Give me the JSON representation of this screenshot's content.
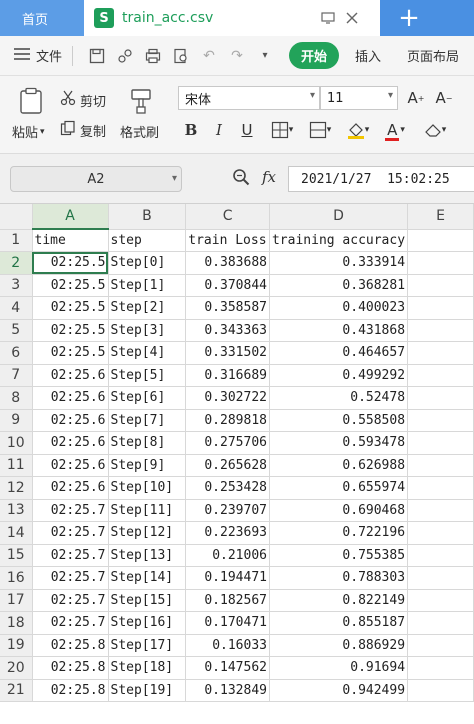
{
  "tabs": {
    "home": "首页",
    "file": "train_acc.csv"
  },
  "menu": {
    "file_label": "文件",
    "start_label": "开始",
    "insert_label": "插入",
    "layout_label": "页面布局"
  },
  "toolbar": {
    "paste_label": "粘贴",
    "cut_label": "剪切",
    "copy_label": "复制",
    "format_painter_label": "格式刷",
    "font_name": "宋体",
    "font_size": "11"
  },
  "formula": {
    "cell_ref": "A2",
    "fx": "fx",
    "value": "2021/1/27  15:02:25"
  },
  "columns": [
    "A",
    "B",
    "C",
    "D",
    "E"
  ],
  "rows": [
    {
      "n": "1",
      "a": "time",
      "b": "step",
      "c": "train Loss",
      "d": "training accuracy"
    },
    {
      "n": "2",
      "a": "02:25.5",
      "b": "Step[0]",
      "c": "0.383688",
      "d": "0.333914"
    },
    {
      "n": "3",
      "a": "02:25.5",
      "b": "Step[1]",
      "c": "0.370844",
      "d": "0.368281"
    },
    {
      "n": "4",
      "a": "02:25.5",
      "b": "Step[2]",
      "c": "0.358587",
      "d": "0.400023"
    },
    {
      "n": "5",
      "a": "02:25.5",
      "b": "Step[3]",
      "c": "0.343363",
      "d": "0.431868"
    },
    {
      "n": "6",
      "a": "02:25.5",
      "b": "Step[4]",
      "c": "0.331502",
      "d": "0.464657"
    },
    {
      "n": "7",
      "a": "02:25.6",
      "b": "Step[5]",
      "c": "0.316689",
      "d": "0.499292"
    },
    {
      "n": "8",
      "a": "02:25.6",
      "b": "Step[6]",
      "c": "0.302722",
      "d": "0.52478"
    },
    {
      "n": "9",
      "a": "02:25.6",
      "b": "Step[7]",
      "c": "0.289818",
      "d": "0.558508"
    },
    {
      "n": "10",
      "a": "02:25.6",
      "b": "Step[8]",
      "c": "0.275706",
      "d": "0.593478"
    },
    {
      "n": "11",
      "a": "02:25.6",
      "b": "Step[9]",
      "c": "0.265628",
      "d": "0.626988"
    },
    {
      "n": "12",
      "a": "02:25.6",
      "b": "Step[10]",
      "c": "0.253428",
      "d": "0.655974"
    },
    {
      "n": "13",
      "a": "02:25.7",
      "b": "Step[11]",
      "c": "0.239707",
      "d": "0.690468"
    },
    {
      "n": "14",
      "a": "02:25.7",
      "b": "Step[12]",
      "c": "0.223693",
      "d": "0.722196"
    },
    {
      "n": "15",
      "a": "02:25.7",
      "b": "Step[13]",
      "c": "0.21006",
      "d": "0.755385"
    },
    {
      "n": "16",
      "a": "02:25.7",
      "b": "Step[14]",
      "c": "0.194471",
      "d": "0.788303"
    },
    {
      "n": "17",
      "a": "02:25.7",
      "b": "Step[15]",
      "c": "0.182567",
      "d": "0.822149"
    },
    {
      "n": "18",
      "a": "02:25.7",
      "b": "Step[16]",
      "c": "0.170471",
      "d": "0.855187"
    },
    {
      "n": "19",
      "a": "02:25.8",
      "b": "Step[17]",
      "c": "0.16033",
      "d": "0.886929"
    },
    {
      "n": "20",
      "a": "02:25.8",
      "b": "Step[18]",
      "c": "0.147562",
      "d": "0.91694"
    },
    {
      "n": "21",
      "a": "02:25.8",
      "b": "Step[19]",
      "c": "0.132849",
      "d": "0.942499"
    }
  ],
  "colors": {
    "tab_blue": "#4a90e2",
    "accent_green": "#22a35a",
    "select_green": "#2e7d4f"
  },
  "icons": [
    "save-icon",
    "undo-icon",
    "redo-icon",
    "print-icon",
    "zoom-icon",
    "bold-icon",
    "italic-icon",
    "underline-icon",
    "border-icon",
    "fill-color-icon",
    "font-color-icon",
    "eraser-icon"
  ]
}
